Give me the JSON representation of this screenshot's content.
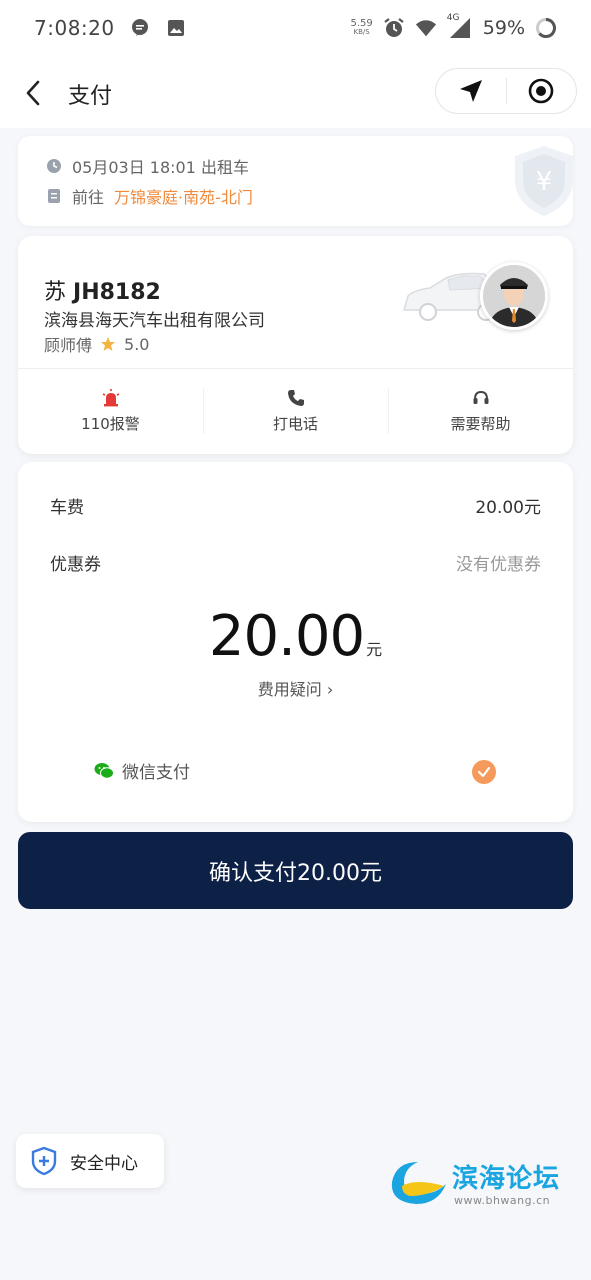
{
  "status_bar": {
    "time": "7:08:20",
    "net_speed": "5.59",
    "net_unit": "KB/S",
    "signal_label": "4G",
    "battery": "59%"
  },
  "header": {
    "title": "支付"
  },
  "trip": {
    "datetime_type": "05月03日 18:01 出租车",
    "dest_prefix": "前往",
    "destination": "万锦豪庭·南苑-北门"
  },
  "driver": {
    "plate_province": "苏",
    "plate_number": "JH8182",
    "company": "滨海县海天汽车出租有限公司",
    "name": "顾师傅",
    "rating": "5.0"
  },
  "driver_actions": [
    {
      "label": "110报警",
      "icon": "alarm-icon"
    },
    {
      "label": "打电话",
      "icon": "phone-icon"
    },
    {
      "label": "需要帮助",
      "icon": "headset-icon"
    }
  ],
  "fees": {
    "fare_label": "车费",
    "fare_value": "20.00元",
    "coupon_label": "优惠券",
    "coupon_value": "没有优惠券",
    "total_amount": "20.00",
    "total_unit": "元",
    "fee_question": "费用疑问 ›"
  },
  "payment": {
    "method": "微信支付",
    "selected": true
  },
  "confirm_button": "确认支付20.00元",
  "safety_center": "安全中心",
  "watermark": {
    "name": "滨海论坛",
    "url": "www.bhwang.cn"
  },
  "colors": {
    "accent_orange": "#f08a3c",
    "confirm_navy": "#0d2045",
    "wechat_green": "#1aad19",
    "alarm_red": "#e53935"
  }
}
